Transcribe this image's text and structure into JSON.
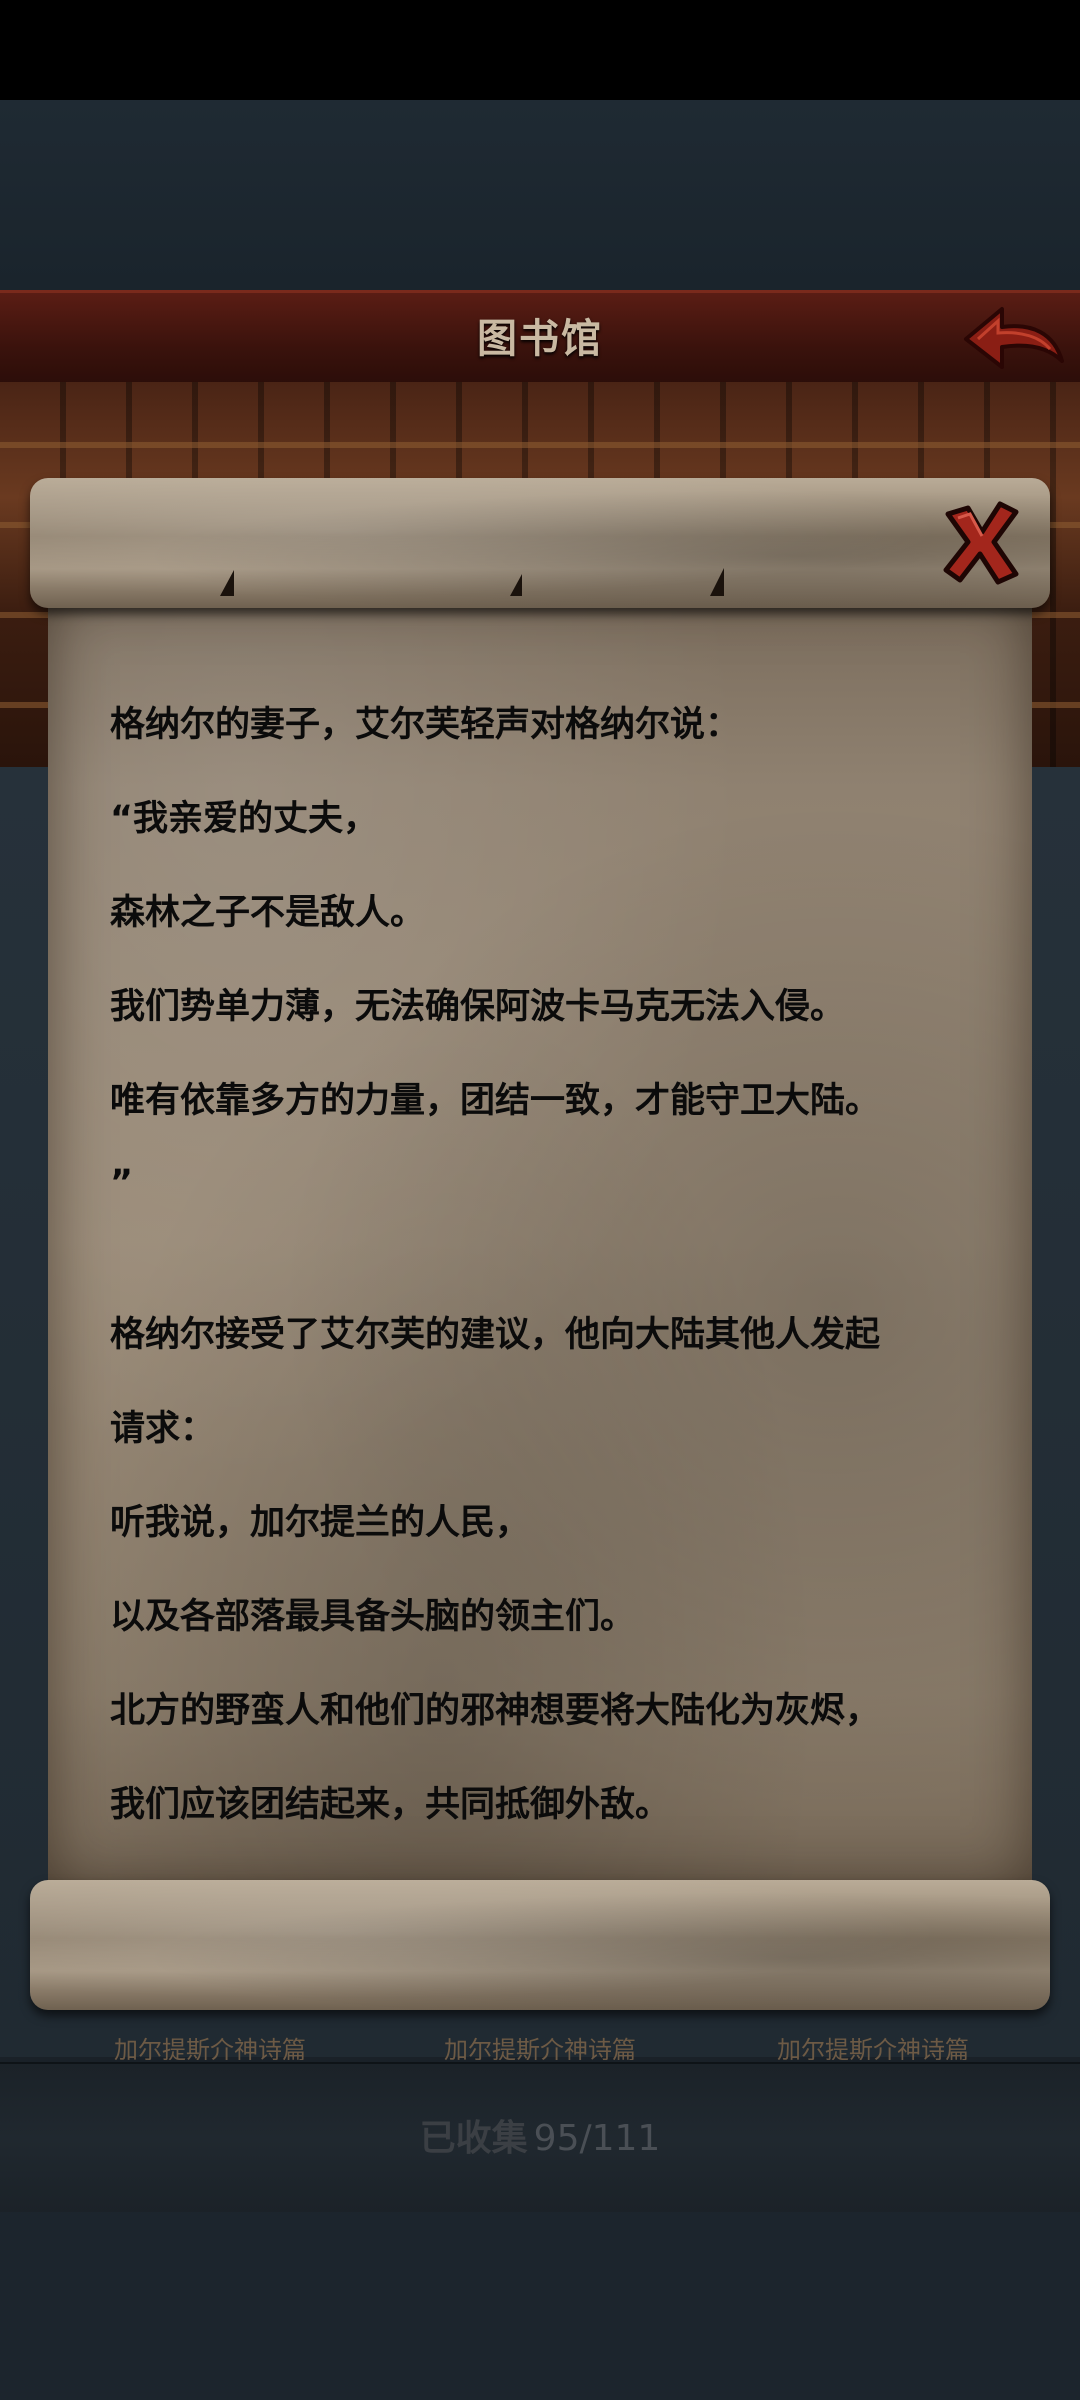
{
  "header": {
    "title": "图书馆",
    "back_icon": "back-arrow-icon"
  },
  "scroll": {
    "close_icon": "close-x-icon",
    "paragraph1": [
      "格纳尔的妻子，艾尔芙轻声对格纳尔说：",
      "“我亲爱的丈夫，",
      "森林之子不是敌人。",
      "我们势单力薄，无法确保阿波卡马克无法入侵。",
      "唯有依靠多方的力量，团结一致，才能守卫大陆。",
      "”"
    ],
    "paragraph2": [
      "格纳尔接受了艾尔芙的建议，他向大陆其他人发起",
      "请求：",
      "听我说，加尔提兰的人民，",
      "以及各部落最具备头脑的领主们。",
      "北方的野蛮人和他们的邪神想要将大陆化为灰烬，",
      "我们应该团结起来，共同抵御外敌。"
    ]
  },
  "cards": [
    {
      "title": "加尔提斯介神诗篇"
    },
    {
      "title": "加尔提斯介神诗篇"
    },
    {
      "title": "加尔提斯介神诗篇"
    }
  ],
  "footer": {
    "collected_label": "已收集",
    "collected_count": "95/111"
  },
  "colors": {
    "title_bar": "#4a1810",
    "back_arrow": "#8a1e14",
    "close_x": "#a3261c",
    "text": "#0b0b0b"
  }
}
